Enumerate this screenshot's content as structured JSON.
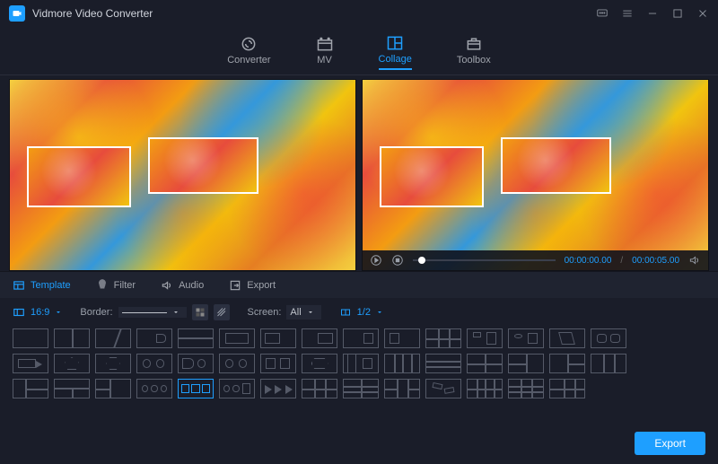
{
  "app": {
    "title": "Vidmore Video Converter"
  },
  "mainTabs": {
    "converter": "Converter",
    "mv": "MV",
    "collage": "Collage",
    "toolbox": "Toolbox",
    "active": "collage"
  },
  "subTabs": {
    "template": "Template",
    "filter": "Filter",
    "audio": "Audio",
    "export": "Export",
    "active": "template"
  },
  "options": {
    "aspect": "16:9",
    "borderLabel": "Border:",
    "screenLabel": "Screen:",
    "screenValue": "All",
    "splitValue": "1/2"
  },
  "playback": {
    "current": "00:00:00.00",
    "total": "00:00:05.00"
  },
  "export": {
    "label": "Export"
  },
  "colors": {
    "accent": "#1e9fff",
    "bg": "#1a1d29"
  }
}
